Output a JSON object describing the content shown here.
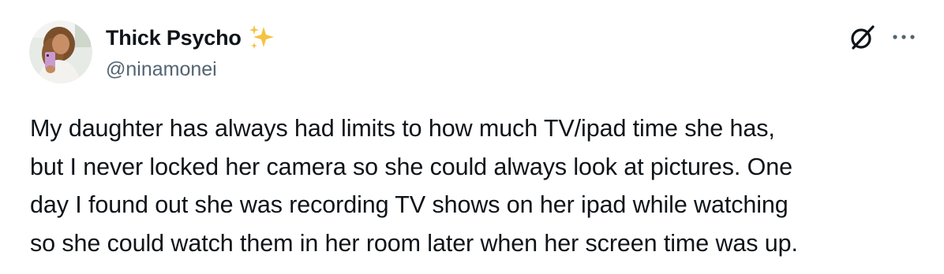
{
  "author": {
    "display_name": "Thick Psycho",
    "handle": "@ninamonei",
    "name_emoji": "sparkles-icon",
    "avatar": "avatar"
  },
  "actions": {
    "grok_icon": "grok-icon",
    "more_icon": "more-icon"
  },
  "tweet": {
    "lines": [
      "My daughter has always had limits to how much TV/ipad time she has,",
      "but I never locked her camera so she could always look at pictures. One",
      "day I found out she was recording TV shows on her ipad while watching",
      "so she could watch them in her room later when her screen time was up."
    ]
  },
  "colors": {
    "text_primary": "#0f1419",
    "text_secondary": "#536471",
    "sparkle": "#f5c342",
    "background": "#ffffff"
  }
}
